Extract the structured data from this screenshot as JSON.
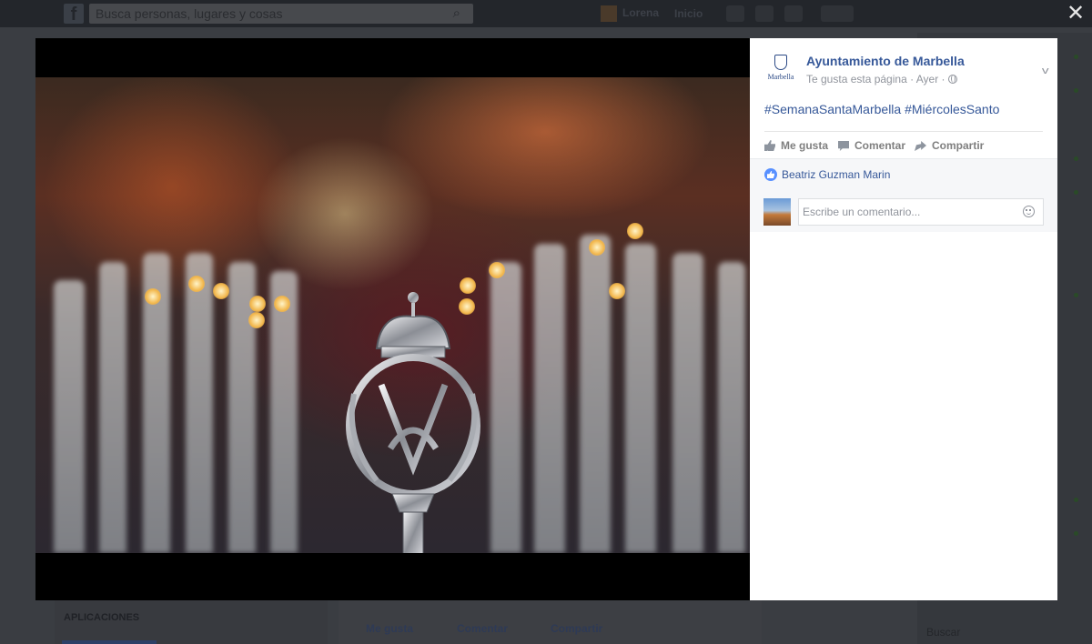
{
  "background": {
    "search_placeholder": "Busca personas, lugares y cosas",
    "user_name": "Lorena",
    "home_label": "Inicio",
    "apps_heading": "APLICACIONES",
    "action_like": "Me gusta",
    "action_comment": "Comentar",
    "action_share": "Compartir",
    "chat_search": "Buscar"
  },
  "photo_post": {
    "page_name": "Ayuntamiento de Marbella",
    "page_logo_text": "Marbella",
    "page_meta": "Te gusta esta página · Ayer ·",
    "caption_tags": [
      "#SemanaSantaMarbella",
      "#MiércolesSanto"
    ],
    "actions": {
      "like": "Me gusta",
      "comment": "Comentar",
      "share": "Compartir"
    },
    "likers": "Beatriz Guzman Marin",
    "comment_placeholder": "Escribe un comentario..."
  },
  "colors": {
    "link_blue": "#365899",
    "muted_gray": "#90949c",
    "like_blue": "#5890ff"
  }
}
